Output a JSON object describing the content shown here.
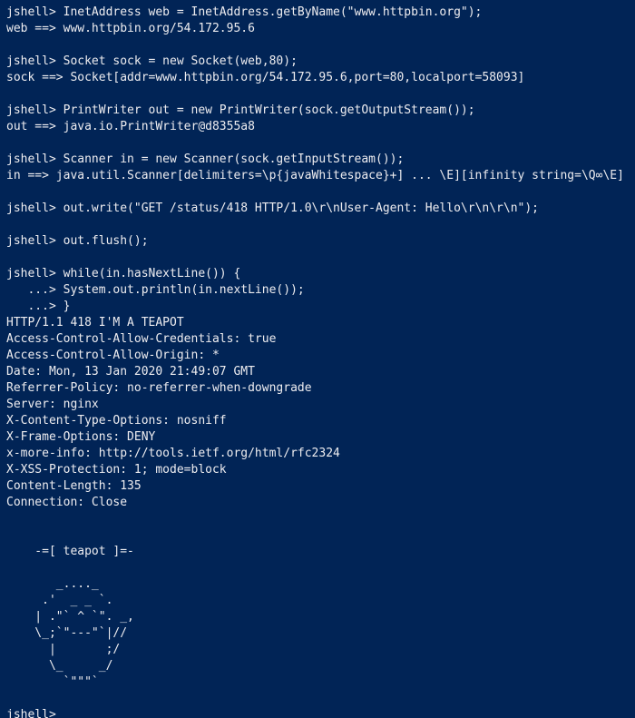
{
  "terminal": {
    "background": "#012456",
    "foreground": "#eeedf0",
    "lines": [
      "jshell> InetAddress web = InetAddress.getByName(\"www.httpbin.org\");",
      "web ==> www.httpbin.org/54.172.95.6",
      "",
      "jshell> Socket sock = new Socket(web,80);",
      "sock ==> Socket[addr=www.httpbin.org/54.172.95.6,port=80,localport=58093]",
      "",
      "jshell> PrintWriter out = new PrintWriter(sock.getOutputStream());",
      "out ==> java.io.PrintWriter@d8355a8",
      "",
      "jshell> Scanner in = new Scanner(sock.getInputStream());",
      "in ==> java.util.Scanner[delimiters=\\p{javaWhitespace}+] ... \\E][infinity string=\\Q∞\\E]",
      "",
      "jshell> out.write(\"GET /status/418 HTTP/1.0\\r\\nUser-Agent: Hello\\r\\n\\r\\n\");",
      "",
      "jshell> out.flush();",
      "",
      "jshell> while(in.hasNextLine()) {",
      "   ...> System.out.println(in.nextLine());",
      "   ...> }",
      "HTTP/1.1 418 I'M A TEAPOT",
      "Access-Control-Allow-Credentials: true",
      "Access-Control-Allow-Origin: *",
      "Date: Mon, 13 Jan 2020 21:49:07 GMT",
      "Referrer-Policy: no-referrer-when-downgrade",
      "Server: nginx",
      "X-Content-Type-Options: nosniff",
      "X-Frame-Options: DENY",
      "x-more-info: http://tools.ietf.org/html/rfc2324",
      "X-XSS-Protection: 1; mode=block",
      "Content-Length: 135",
      "Connection: Close",
      "",
      "",
      "    -=[ teapot ]=-",
      "",
      "       _...._",
      "     .'  _ _ `.",
      "    | .\"` ^ `\". _,",
      "    \\_;`\"---\"`|//",
      "      |       ;/",
      "      \\_     _/",
      "        `\"\"\"`",
      "",
      "jshell>"
    ]
  }
}
